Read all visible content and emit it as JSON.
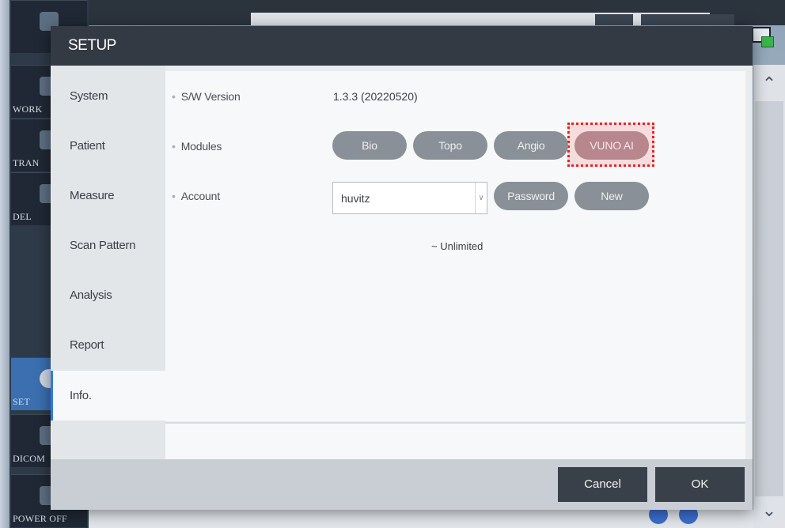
{
  "background": {
    "sidebar_tiles": [
      {
        "label": "",
        "icon": "refresh-icon"
      },
      {
        "label": "WORK",
        "icon": "worklist-icon"
      },
      {
        "label": "TRAN",
        "icon": "transfer-icon"
      },
      {
        "label": "DEL",
        "icon": "trash-icon"
      },
      {
        "label": "SET",
        "icon": "gear-icon"
      },
      {
        "label": "DICOM",
        "icon": "dicom-icon"
      },
      {
        "label": "POWER OFF",
        "icon": "power-icon"
      }
    ]
  },
  "dialog": {
    "title": "SETUP",
    "nav": [
      {
        "label": "System"
      },
      {
        "label": "Patient"
      },
      {
        "label": "Measure"
      },
      {
        "label": "Scan Pattern"
      },
      {
        "label": "Analysis"
      },
      {
        "label": "Report"
      },
      {
        "label": "Info.",
        "active": true
      }
    ],
    "info": {
      "sw_version_label": "S/W Version",
      "sw_version_value": "1.3.3 (20220520)",
      "modules_label": "Modules",
      "modules": [
        "Bio",
        "Topo",
        "Angio",
        "VUNO AI"
      ],
      "account_label": "Account",
      "account_selected": "huvitz",
      "password_button": "Password",
      "new_button": "New",
      "license_text": "~ Unlimited"
    },
    "footer": {
      "cancel_label": "Cancel",
      "ok_label": "OK"
    }
  },
  "colors": {
    "header": "#333a44",
    "active_accent": "#2f7be0",
    "highlight_border": "#e8231f",
    "pill": "#8a9097",
    "pill_vuno": "#b8868d"
  }
}
